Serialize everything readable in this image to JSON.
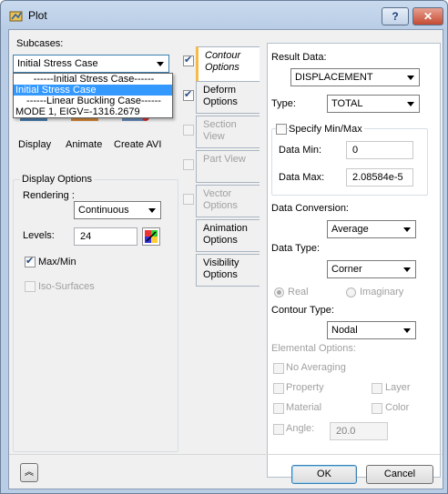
{
  "window": {
    "title": "Plot",
    "help_glyph": "?",
    "close_glyph": "✕"
  },
  "left": {
    "subcases_label": "Subcases:",
    "subcase_selected": "Initial Stress Case",
    "subcase_options": [
      "------Initial Stress Case------",
      "Initial Stress Case",
      "------Linear Buckling Case------",
      "MODE 1, EIGV=-1316.2679"
    ],
    "buttons": {
      "display": "Display",
      "animate": "Animate",
      "create_avi": "Create AVI"
    },
    "display_options": {
      "title": "Display Options",
      "rendering_label": "Rendering :",
      "rendering_value": "Continuous",
      "levels_label": "Levels:",
      "levels_value": "24",
      "maxmin_label": "Max/Min",
      "maxmin_checked": true,
      "isosurfaces_label": "Iso-Surfaces",
      "isosurfaces_checked": false
    }
  },
  "tabs": [
    {
      "label": "Contour Options",
      "checked": true,
      "active": true,
      "enabled": true
    },
    {
      "label": "Deform Options",
      "checked": true,
      "active": false,
      "enabled": true
    },
    {
      "label": "Section View",
      "checked": false,
      "active": false,
      "enabled": false
    },
    {
      "label": "Part View",
      "checked": false,
      "active": false,
      "enabled": false
    },
    {
      "label": "Vector Options",
      "checked": false,
      "active": false,
      "enabled": false
    },
    {
      "label": "Animation Options",
      "active": false,
      "enabled": true
    },
    {
      "label": "Visibility Options",
      "active": false,
      "enabled": true
    }
  ],
  "contour": {
    "result_data_label": "Result Data:",
    "result_data_value": "DISPLACEMENT",
    "type_label": "Type:",
    "type_value": "TOTAL",
    "specify_minmax_label": "Specify Min/Max",
    "data_min_label": "Data Min:",
    "data_min_value": "0",
    "data_max_label": "Data Max:",
    "data_max_value": "2.08584e-5",
    "data_conversion_label": "Data Conversion:",
    "data_conversion_value": "Average",
    "data_type_label": "Data Type:",
    "data_type_value": "Corner",
    "real_label": "Real",
    "imaginary_label": "Imaginary",
    "contour_type_label": "Contour Type:",
    "contour_type_value": "Nodal",
    "elemental_options_label": "Elemental Options:",
    "no_averaging_label": "No Averaging",
    "property_label": "Property",
    "layer_label": "Layer",
    "material_label": "Material",
    "color_label": "Color",
    "angle_label": "Angle:",
    "angle_value": "20.0"
  },
  "footer": {
    "expand_glyph": "︽",
    "ok": "OK",
    "cancel": "Cancel"
  }
}
